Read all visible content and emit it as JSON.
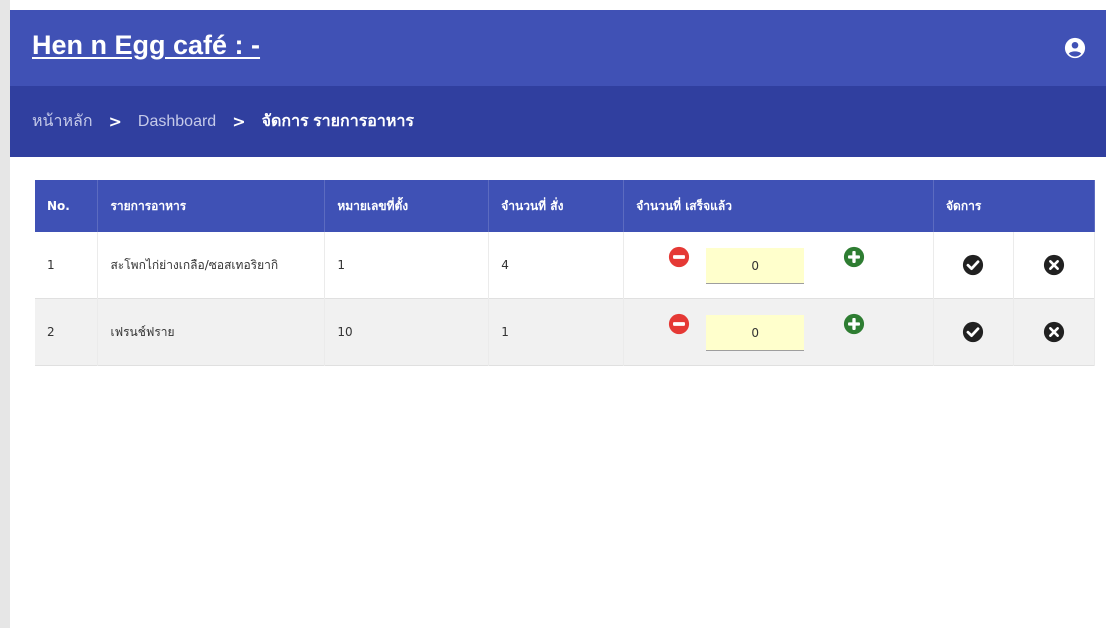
{
  "header": {
    "title": "Hen n Egg café : -",
    "account_icon": "account-circle-icon"
  },
  "breadcrumb": {
    "items": [
      "หน้าหลัก",
      "Dashboard",
      "จัดการ รายการอาหาร"
    ],
    "separator": ">"
  },
  "table": {
    "headers": [
      "No.",
      "รายการอาหาร",
      "หมายเลขที่ตั้ง",
      "จำนวนที่ สั่ง",
      "จำนวนที่ เสร็จแล้ว",
      "จัดการ"
    ],
    "rows": [
      {
        "no": "1",
        "item": "สะโพกไก่ย่างเกลือ/ซอสเทอริยากิ",
        "table_no": "1",
        "ordered": "4",
        "done": "0"
      },
      {
        "no": "2",
        "item": "เฟรนช์ฟราย",
        "table_no": "10",
        "ordered": "1",
        "done": "0"
      }
    ]
  },
  "icons": {
    "decrease": "minus-circle-icon",
    "increase": "plus-circle-icon",
    "confirm": "check-circle-icon",
    "cancel": "x-circle-icon"
  },
  "colors": {
    "header_bg": "#4051b5",
    "breadcrumb_bg": "#303f9f",
    "table_header_bg": "#3f51b5",
    "minus_red": "#e53935",
    "plus_green": "#2e7d32",
    "qty_input_bg": "#ffffcc"
  }
}
